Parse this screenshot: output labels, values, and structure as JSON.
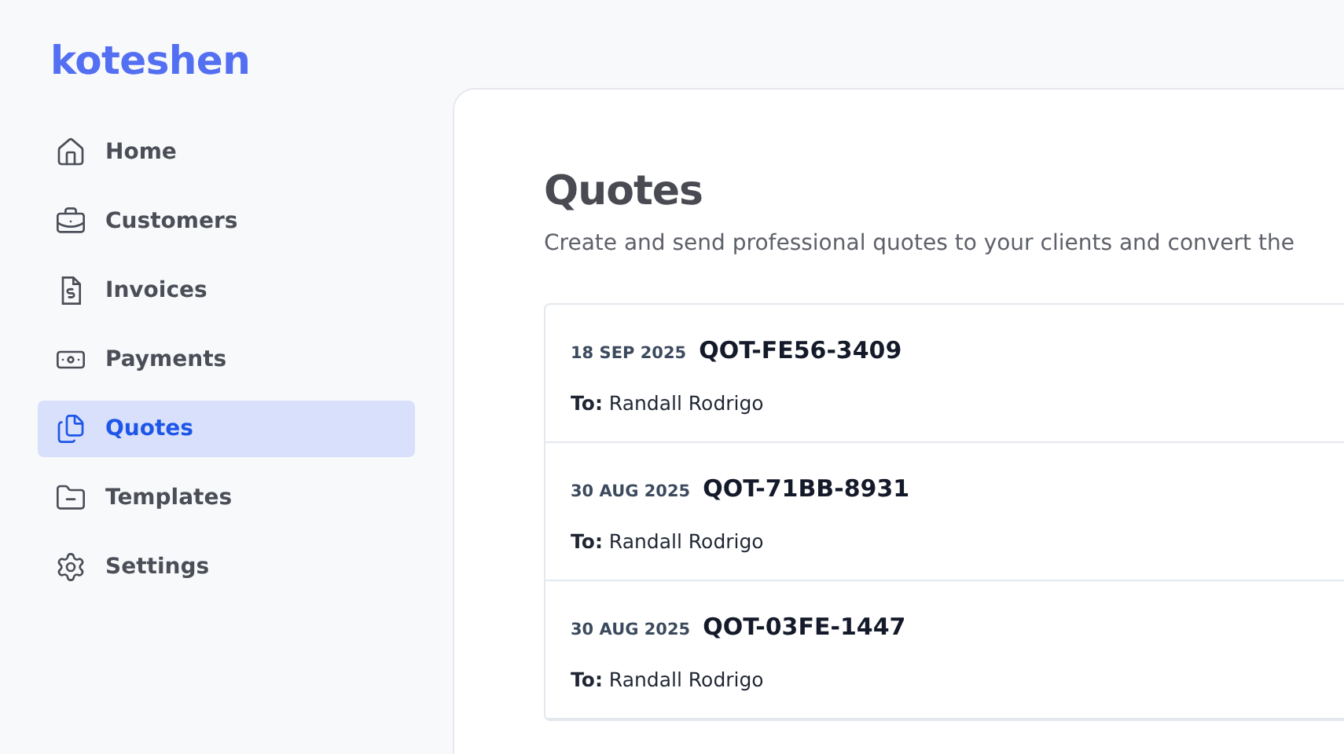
{
  "brand": "koteshen",
  "sidebar": {
    "items": [
      {
        "label": "Home",
        "selected": false
      },
      {
        "label": "Customers",
        "selected": false
      },
      {
        "label": "Invoices",
        "selected": false
      },
      {
        "label": "Payments",
        "selected": false
      },
      {
        "label": "Quotes",
        "selected": true
      },
      {
        "label": "Templates",
        "selected": false
      },
      {
        "label": "Settings",
        "selected": false
      }
    ]
  },
  "page": {
    "title": "Quotes",
    "subtitle": "Create and send professional quotes to your clients and convert the"
  },
  "quotes": [
    {
      "date": "18 SEP 2025",
      "number": "QOT-FE56-3409",
      "recipient": "**To:** Randall Rodrigo"
    },
    {
      "date": "30 AUG 2025",
      "number": "QOT-71BB-8931",
      "recipient": "**To:** Randall Rodrigo"
    },
    {
      "date": "30 AUG 2025",
      "number": "QOT-03FE-1447",
      "recipient": "**To:** Randall Rodrigo"
    }
  ]
}
